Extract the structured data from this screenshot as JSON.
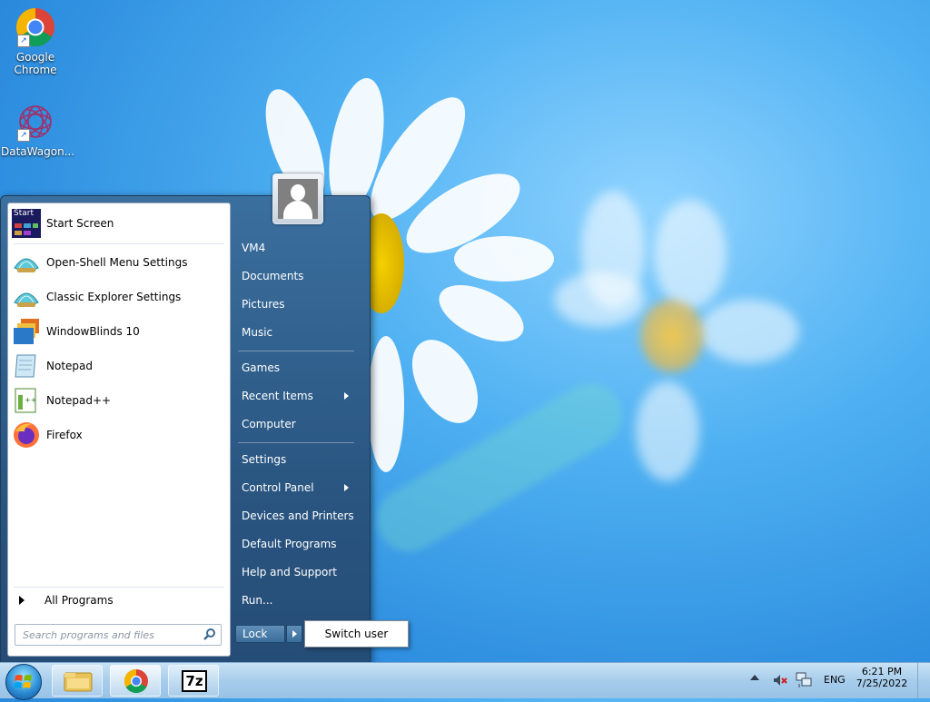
{
  "desktop": {
    "icons": [
      {
        "label_line1": "Google",
        "label_line2": "Chrome"
      },
      {
        "label_line1": "DataWagon...",
        "label_line2": ""
      }
    ]
  },
  "start_menu": {
    "programs": [
      {
        "label": "Start Screen",
        "icon": "start-screen-icon"
      },
      {
        "label": "Open-Shell Menu Settings",
        "icon": "shell-icon"
      },
      {
        "label": "Classic Explorer Settings",
        "icon": "shell-icon"
      },
      {
        "label": "WindowBlinds 10",
        "icon": "windowblinds-icon"
      },
      {
        "label": "Notepad",
        "icon": "notepad-icon"
      },
      {
        "label": "Notepad++",
        "icon": "notepadpp-icon"
      },
      {
        "label": "Firefox",
        "icon": "firefox-icon"
      }
    ],
    "start_screen_icon_text": "Start",
    "all_programs": "All Programs",
    "search_placeholder": "Search programs and files",
    "right_items": [
      {
        "label": "VM4"
      },
      {
        "label": "Documents"
      },
      {
        "label": "Pictures"
      },
      {
        "label": "Music"
      },
      {
        "label": "Games"
      },
      {
        "label": "Recent Items"
      },
      {
        "label": "Computer"
      },
      {
        "label": "Settings"
      },
      {
        "label": "Control Panel"
      },
      {
        "label": "Devices and Printers"
      },
      {
        "label": "Default Programs"
      },
      {
        "label": "Help and Support"
      },
      {
        "label": "Run..."
      }
    ],
    "lock_label": "Lock",
    "switch_user_label": "Switch user"
  },
  "taskbar": {
    "seven_zip_label": "7z",
    "language": "ENG",
    "time": "6:21 PM",
    "date": "7/25/2022"
  },
  "colors": {
    "menu_blue": "#2a5682",
    "taskbar": "#a7cdec"
  }
}
